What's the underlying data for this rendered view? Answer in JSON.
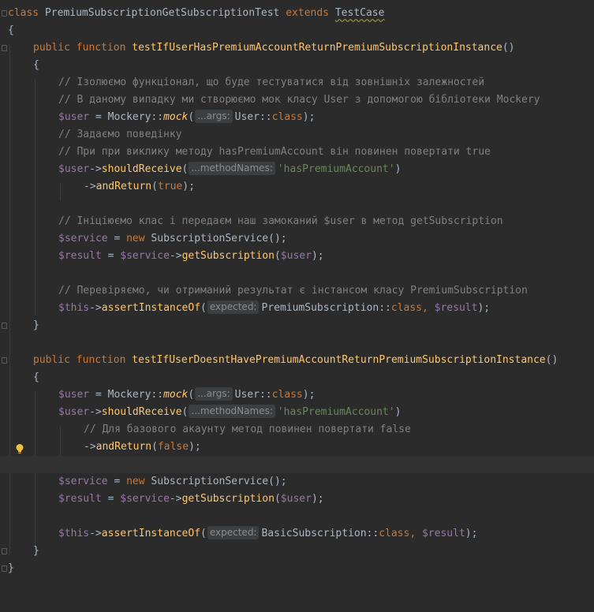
{
  "code": {
    "class_kw": "class",
    "class_name": "PremiumSubscriptionGetSubscriptionTest",
    "extends_kw": "extends",
    "parent_class": "TestCase",
    "brace_open": "{",
    "brace_close": "}",
    "method1": {
      "visibility": "public",
      "function_kw": "function",
      "name": "testIfUserHasPremiumAccountReturnPremiumSubscriptionInstance",
      "parens": "()",
      "comment_isolate": "// Ізолюємо функціонал, що буде тестуватися від зовнішніх залежностей",
      "comment_mock": "// В даному випадку ми створюємо мок класу User з допомогою бібліотеки Mockery",
      "comment_behavior": "// Задаємо поведінку",
      "comment_call": "// При при виклику методу hasPremiumAccount він повинен повертати true",
      "return_value": "true",
      "comment_init": "// Ініціюємо клас і передаєм наш замоканий $user в метод getSubscription",
      "comment_check": "// Перевіряємо, чи отриманий результат є інстансом класу PremiumSubscription",
      "expected_class": "PremiumSubscription"
    },
    "method2": {
      "visibility": "public",
      "function_kw": "function",
      "name": "testIfUserDoesntHavePremiumAccountReturnPremiumSubscriptionInstance",
      "parens": "()",
      "comment_basic": "// Для базового акаунту метод повинен повертати false",
      "return_value": "false",
      "expected_class": "BasicSubscription"
    },
    "tokens": {
      "user_var": "$user",
      "service_var": "$service",
      "result_var": "$result",
      "this_var": "$this",
      "eq": " = ",
      "mockery": "Mockery",
      "scope": "::",
      "mock_fn": "mock",
      "user_class": "User",
      "class_kw": "class",
      "arrow": "->",
      "should_receive": "shouldReceive",
      "has_premium_str": "'hasPremiumAccount'",
      "and_return": "andReturn",
      "new_kw": "new",
      "service_class": "SubscriptionService",
      "get_subscription": "getSubscription",
      "assert_instance_of": "assertInstanceOf",
      "comma": ", ",
      "semicolon": ";",
      "open_paren": "(",
      "close_paren": ")",
      "close_paren_semi": ");",
      "empty_call": "();"
    },
    "hints": {
      "args": "...args:",
      "method_names": "...methodNames:",
      "expected": "expected:"
    }
  },
  "colors": {
    "background": "#2b2b2b",
    "keyword": "#cc7832",
    "function": "#ffc66d",
    "comment": "#808080",
    "variable": "#9876aa",
    "string": "#6a8759",
    "default_text": "#a9b7c6",
    "lightbulb": "#f0c040"
  },
  "icons": {
    "fold_markers": "fold-marker-icon",
    "intention": "lightbulb-icon"
  }
}
